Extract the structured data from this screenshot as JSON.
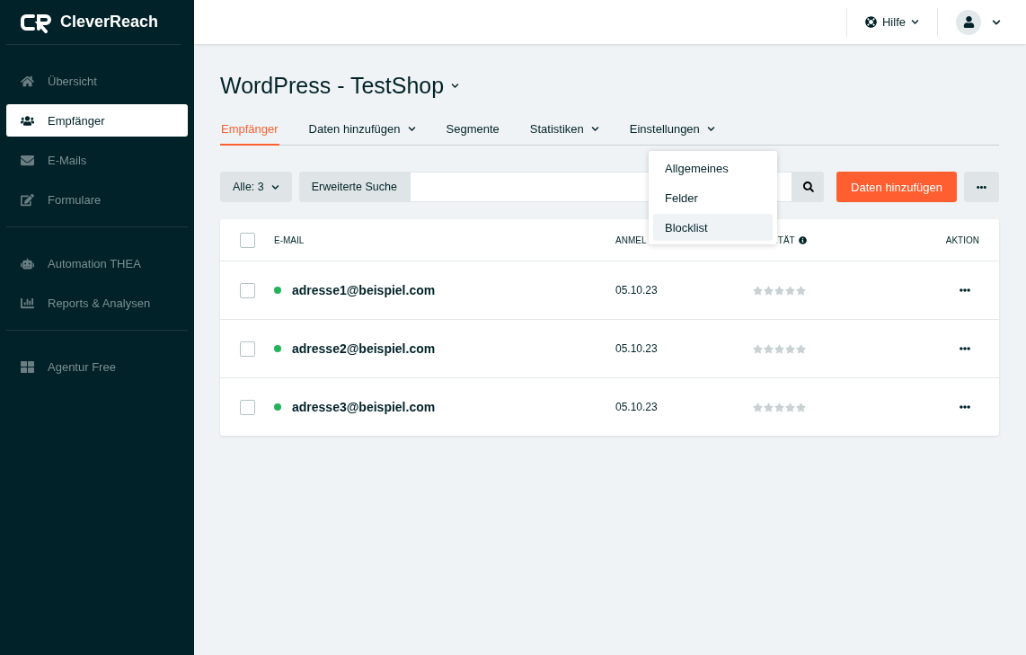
{
  "logo": {
    "text": "CleverReach"
  },
  "sidebar": {
    "sections": [
      [
        {
          "label": "Übersicht",
          "kind": "home",
          "selected": false
        },
        {
          "label": "Empfänger",
          "kind": "users",
          "selected": true
        },
        {
          "label": "E-Mails",
          "kind": "mail",
          "selected": false
        },
        {
          "label": "Formulare",
          "kind": "edit",
          "selected": false
        }
      ],
      [
        {
          "label": "Automation THEA",
          "kind": "robot",
          "selected": false
        },
        {
          "label": "Reports & Analysen",
          "kind": "chart",
          "selected": false
        }
      ],
      [
        {
          "label": "Agentur Free",
          "kind": "grid",
          "selected": false
        }
      ]
    ]
  },
  "topbar": {
    "help": "Hilfe"
  },
  "page": {
    "title": "WordPress - TestShop"
  },
  "tabs": [
    {
      "label": "Empfänger",
      "selected": true,
      "has_menu": false
    },
    {
      "label": "Daten hinzufügen",
      "selected": false,
      "has_menu": true
    },
    {
      "label": "Segmente",
      "selected": false,
      "has_menu": false
    },
    {
      "label": "Statistiken",
      "selected": false,
      "has_menu": true
    },
    {
      "label": "Einstellungen",
      "selected": false,
      "has_menu": true
    }
  ],
  "menu": {
    "items": [
      {
        "label": "Allgemeines",
        "selected": false
      },
      {
        "label": "Felder",
        "selected": false
      },
      {
        "label": "Blocklist",
        "selected": true
      }
    ]
  },
  "toolbar": {
    "filter": "Alle: 3",
    "advanced_search": "Erweiterte Suche",
    "add_button": "Daten hinzufügen"
  },
  "table": {
    "all_checked": false,
    "columns": [
      "E-MAIL",
      "ANMEL",
      "ITÄT",
      "AKTION"
    ],
    "rows": [
      {
        "email": "adresse1@beispiel.com",
        "color": "#22b45a",
        "date": "05.10.23",
        "stars": 0,
        "checked": false
      },
      {
        "email": "adresse2@beispiel.com",
        "color": "#22b45a",
        "date": "05.10.23",
        "stars": 0,
        "checked": false
      },
      {
        "email": "adresse3@beispiel.com",
        "color": "#22b45a",
        "date": "05.10.23",
        "stars": 0,
        "checked": false
      }
    ]
  }
}
